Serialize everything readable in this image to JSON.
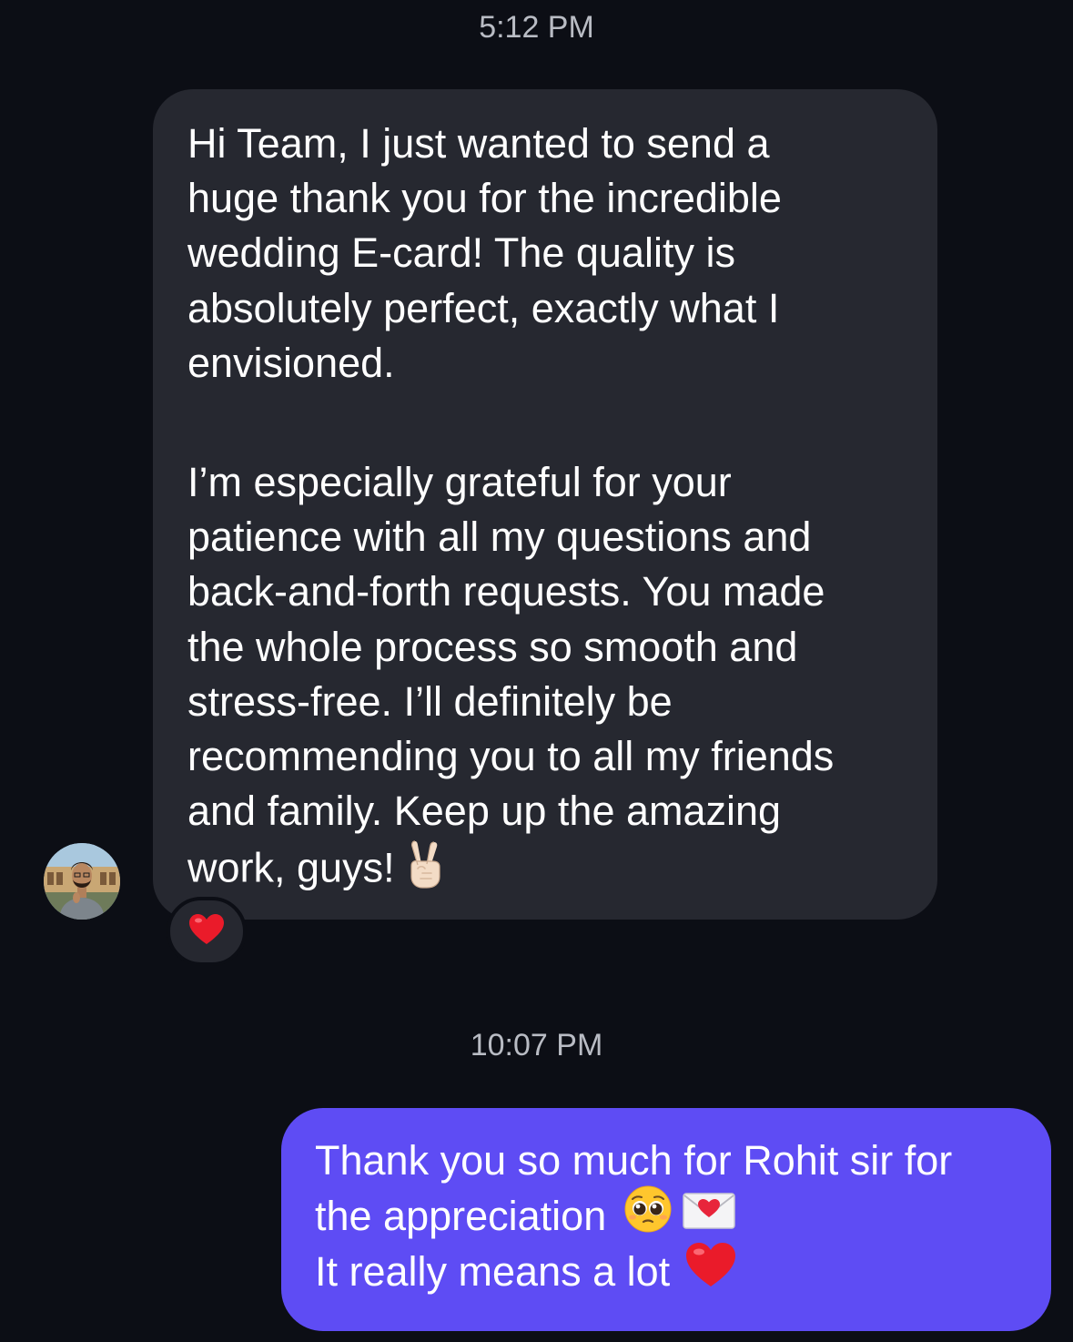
{
  "conversation": {
    "timestamp_first": "5:12 PM",
    "incoming_message": {
      "paragraph_1": "Hi Team, I just wanted to send a\nhuge thank you for the incredible\nwedding E-card! The quality is\nabsolutely perfect, exactly what I\nenvisioned.",
      "paragraph_2": "I’m especially grateful for your\npatience with all my questions and\nback-and-forth requests. You made\nthe whole process so smooth and\nstress-free. I’ll definitely be\nrecommending you to all my friends\nand family. Keep up the amazing\nwork, guys!",
      "trailing_emoji": "victory-hand-emoji",
      "reaction": "red-heart-emoji"
    },
    "timestamp_second": "10:07 PM",
    "outgoing_message": {
      "line_1": "Thank you so much for Rohit sir for",
      "line_2": "the appreciation",
      "line_2_emojis": [
        "pleading-face-emoji",
        "love-letter-emoji"
      ],
      "line_3": "It really means a lot",
      "line_3_emoji": "red-heart-emoji"
    }
  },
  "colors": {
    "background": "#0c0e15",
    "incoming_bubble": "#262830",
    "outgoing_bubble": "#5e4cf4",
    "timestamp_text": "#b9bcc4"
  }
}
